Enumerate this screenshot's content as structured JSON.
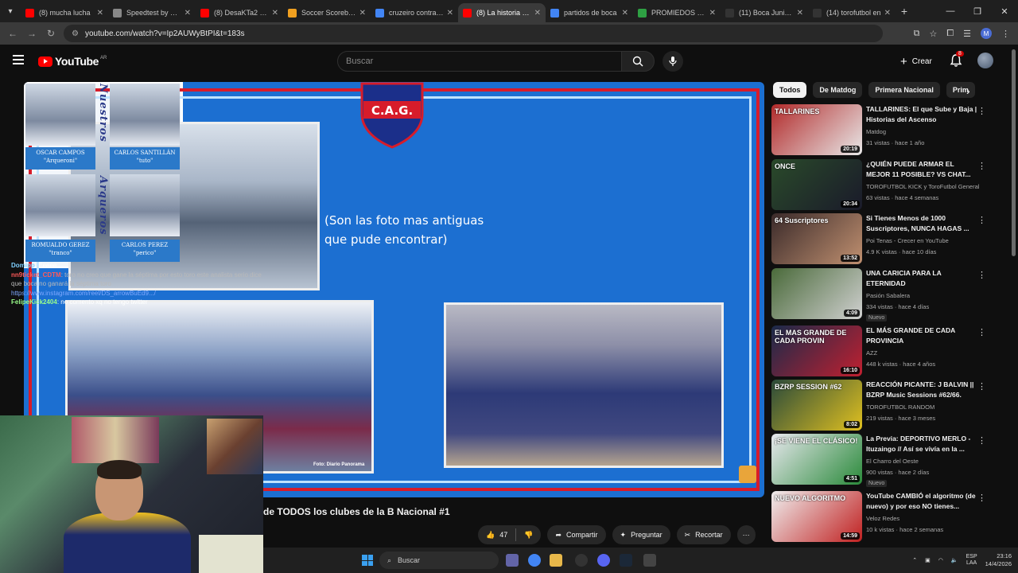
{
  "browser": {
    "tabs": [
      {
        "title": "(8) mucha lucha",
        "color": "#ff0000"
      },
      {
        "title": "Speedtest by Ookla",
        "color": "#888888"
      },
      {
        "title": "(8) DesaKTa2 // N",
        "color": "#ff0000"
      },
      {
        "title": "Soccer Scorebug",
        "color": "#f0a020"
      },
      {
        "title": "cruzeiro contra bo",
        "color": "#4285f4"
      },
      {
        "title": "(8) La historia del",
        "color": "#ff0000"
      },
      {
        "title": "partidos de boca",
        "color": "#4285f4"
      },
      {
        "title": "PROMIEDOS - Fu",
        "color": "#2ea043"
      },
      {
        "title": "(11) Boca Juniors",
        "color": "#333333"
      },
      {
        "title": "(14) torofutbol en",
        "color": "#333333"
      }
    ],
    "active_tab_index": 5,
    "url": "youtube.com/watch?v=Ip2AUWyBtPI&t=183s"
  },
  "header": {
    "logo": "YouTube",
    "country": "AR",
    "search_placeholder": "Buscar",
    "create_label": "Crear",
    "notif_count": "8"
  },
  "video": {
    "title": "de TODOS los clubes de la B Nacional #1",
    "caption_line1": "(Son las foto mas antiguas",
    "caption_line2": "que pude encontrar)",
    "crest_text": "C.A.G.",
    "photo_credit": "Foto: Diario Panorama",
    "vertical_1": "Nuestros",
    "vertical_2": "Arqueros",
    "keepers": [
      {
        "name": "OSCAR CAMPOS",
        "nick": "\"Arqueroni\""
      },
      {
        "name": "CARLOS SANTILLÁN",
        "nick": "\"tuto\""
      },
      {
        "name": "ROMUALDO GEREZ",
        "nick": "\"tranco\""
      },
      {
        "name": "CARLOS PEREZ",
        "nick": "\"perico\""
      }
    ],
    "likes": "47",
    "share_label": "Compartir",
    "ask_label": "Preguntar",
    "clip_label": "Recortar"
  },
  "chat": [
    {
      "name": "Domipp",
      "text": ": Eeeee"
    },
    {
      "name": "nn9ticket_CDTM",
      "text": ": toro no creo que gane la séptima por esto toro este analista serio dice que boca no ganará la séptima toro"
    },
    {
      "name": "",
      "text": "https://www.instagram.com/reel/DS_arrowBuEd9.../"
    },
    {
      "name": "FelipeKick2404",
      "text": ": no comento xq no tengo twitter"
    }
  ],
  "chips": [
    "Todos",
    "De Matdog",
    "Primera Nacional",
    "Prim"
  ],
  "recommendations": [
    {
      "title": "TALLARINES: El que Sube y Baja | Historias del Ascenso",
      "channel": "Matdog",
      "meta": "31 vistas · hace 1 año",
      "duration": "20:19",
      "badge": "",
      "thumb_text": "TALLARINES",
      "c1": "#b22a2a",
      "c2": "#e8e8e8"
    },
    {
      "title": "¿QUIÉN PUEDE ARMAR EL MEJOR 11 POSIBLE? VS CHAT...",
      "channel": "TOROFUTBOL KICK y TorоFutbol General",
      "meta": "63 vistas · hace 4 semanas",
      "duration": "20:34",
      "badge": "",
      "thumb_text": "ONCE",
      "c1": "#2a4a2a",
      "c2": "#1a1a2a"
    },
    {
      "title": "Si Tienes Menos de 1000 Suscriptores, NUNCA HAGAS ...",
      "channel": "Poi Tenas - Crecer en YouTube",
      "meta": "4.9 K vistas · hace 10 días",
      "duration": "13:52",
      "badge": "",
      "thumb_text": "64 Suscriptores",
      "c1": "#3a2a2a",
      "c2": "#c09070"
    },
    {
      "title": "UNA CARICIA PARA LA ETERNIDAD",
      "channel": "Pasión Sabalera",
      "meta": "334 vistas · hace 4 días",
      "duration": "4:09",
      "badge": "Nuevo",
      "thumb_text": "",
      "c1": "#4a6a3a",
      "c2": "#d0d0d0"
    },
    {
      "title": "EL MÁS GRANDE DE CADA PROVINCIA",
      "channel": "AZZ",
      "meta": "448 k vistas · hace 4 años",
      "duration": "16:10",
      "badge": "",
      "thumb_text": "EL MAS GRANDE DE CADA PROVIN",
      "c1": "#1a2a4a",
      "c2": "#c02030"
    },
    {
      "title": "REACCIÓN PICANTE: J BALVIN || BZRP Music Sessions #62/66.",
      "channel": "TOROFUTBOL RANDOM",
      "meta": "219 vistas · hace 3 meses",
      "duration": "8:02",
      "badge": "",
      "thumb_text": "BZRP SESSION #62",
      "c1": "#2a4a3a",
      "c2": "#e0c020"
    },
    {
      "title": "La Previa: DEPORTIVO MERLO - Ituzaingo // Así se vivía en la ...",
      "channel": "El Charro del Oeste",
      "meta": "900 vistas · hace 2 días",
      "duration": "4:51",
      "badge": "Nuevo",
      "thumb_text": "¡SE VIENE EL CLÁSICO!",
      "c1": "#e8e8ee",
      "c2": "#2a8a3a"
    },
    {
      "title": "YouTube CAMBIÓ el algoritmo (de nuevo) y por eso NO tienes...",
      "channel": "Veloz Redes",
      "meta": "10 k vistas · hace 2 semanas",
      "duration": "14:59",
      "badge": "",
      "thumb_text": "NUEVO ALGORITMO",
      "c1": "#f0f0f0",
      "c2": "#c02020"
    }
  ],
  "taskbar": {
    "search": "Buscar",
    "lang1": "ESP",
    "lang2": "LAA",
    "time": "23:16",
    "date": "14/4/2026"
  }
}
